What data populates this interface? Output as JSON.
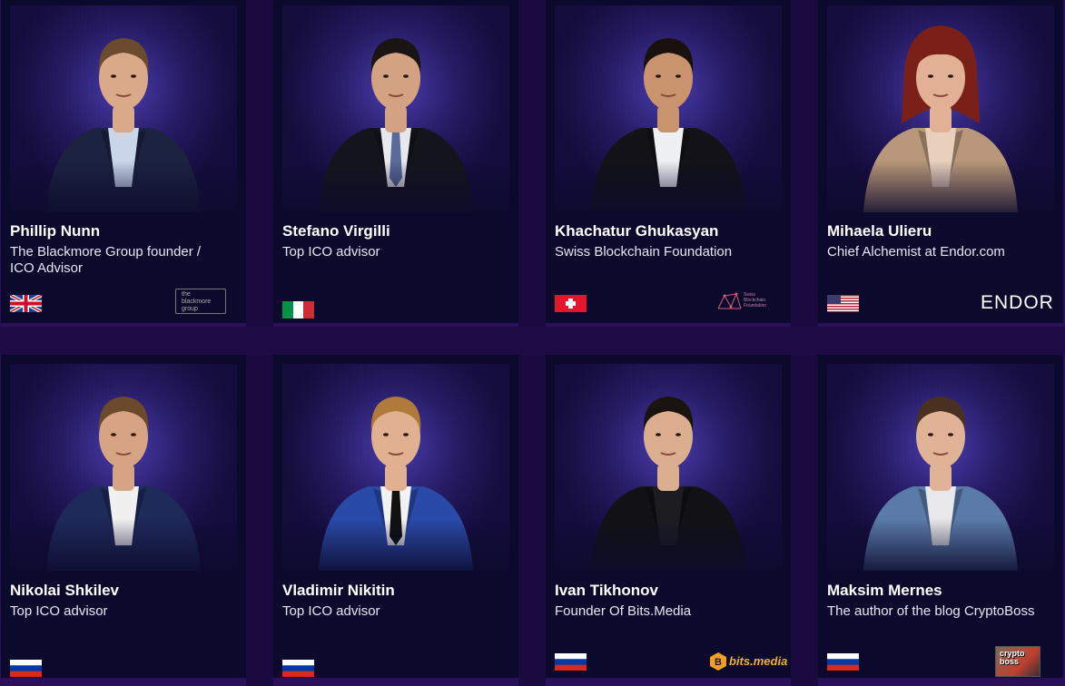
{
  "advisors": [
    {
      "name": "Phillip Nunn",
      "role": "The Blackmore Group founder / ICO Advisor",
      "flag": "uk-flag",
      "logo": "the blackmore group",
      "skin": "#d9a98a",
      "hair": "#6b4a2e",
      "suit": "#1c2340",
      "shirt": "#c9d6ea",
      "tie": ""
    },
    {
      "name": "Stefano Virgilli",
      "role": "Top ICO advisor",
      "flag": "italy-flag",
      "logo": "",
      "skin": "#d2a283",
      "hair": "#1a1412",
      "suit": "#14151c",
      "shirt": "#e6e8ee",
      "tie": "#5a6a9a"
    },
    {
      "name": "Khachatur Ghukasyan",
      "role": "Swiss Blockchain Foundation",
      "flag": "switzerland-flag",
      "logo": "Swiss Blockchain Foundation",
      "skin": "#c8936d",
      "hair": "#18110d",
      "suit": "#121218",
      "shirt": "#eef0f4",
      "tie": ""
    },
    {
      "name": "Mihaela Ulieru",
      "role": "Chief Alchemist at Endor.com",
      "flag": "usa-flag",
      "logo": "ENDOR",
      "skin": "#e2b094",
      "hair": "#7a2018",
      "suit": "#b8977a",
      "shirt": "#e8d0bc",
      "tie": ""
    },
    {
      "name": "Nikolai Shkilev",
      "role": "Top ICO advisor",
      "flag": "russia-flag",
      "logo": "",
      "skin": "#d6a485",
      "hair": "#6a4a2a",
      "suit": "#1e2a5a",
      "shirt": "#f0f0f0",
      "tie": ""
    },
    {
      "name": "Vladimir Nikitin",
      "role": "Top ICO advisor",
      "flag": "russia-flag",
      "logo": "",
      "skin": "#e0b090",
      "hair": "#b07a3a",
      "suit": "#2a4aa8",
      "shirt": "#f2f2f2",
      "tie": "#101010"
    },
    {
      "name": "Ivan Tikhonov",
      "role": "Founder Of Bits.Media",
      "flag": "russia-flag",
      "logo": "bits.media",
      "skin": "#dcae90",
      "hair": "#1a1410",
      "suit": "#121216",
      "shirt": "#1c1c22",
      "tie": ""
    },
    {
      "name": "Maksim Mernes",
      "role": "The author of the blog CryptoBoss",
      "flag": "russia-flag",
      "logo": "crypto boss",
      "skin": "#e0b396",
      "hair": "#4a3020",
      "suit": "#5a7aa8",
      "shirt": "#e8e8ea",
      "tie": ""
    }
  ]
}
